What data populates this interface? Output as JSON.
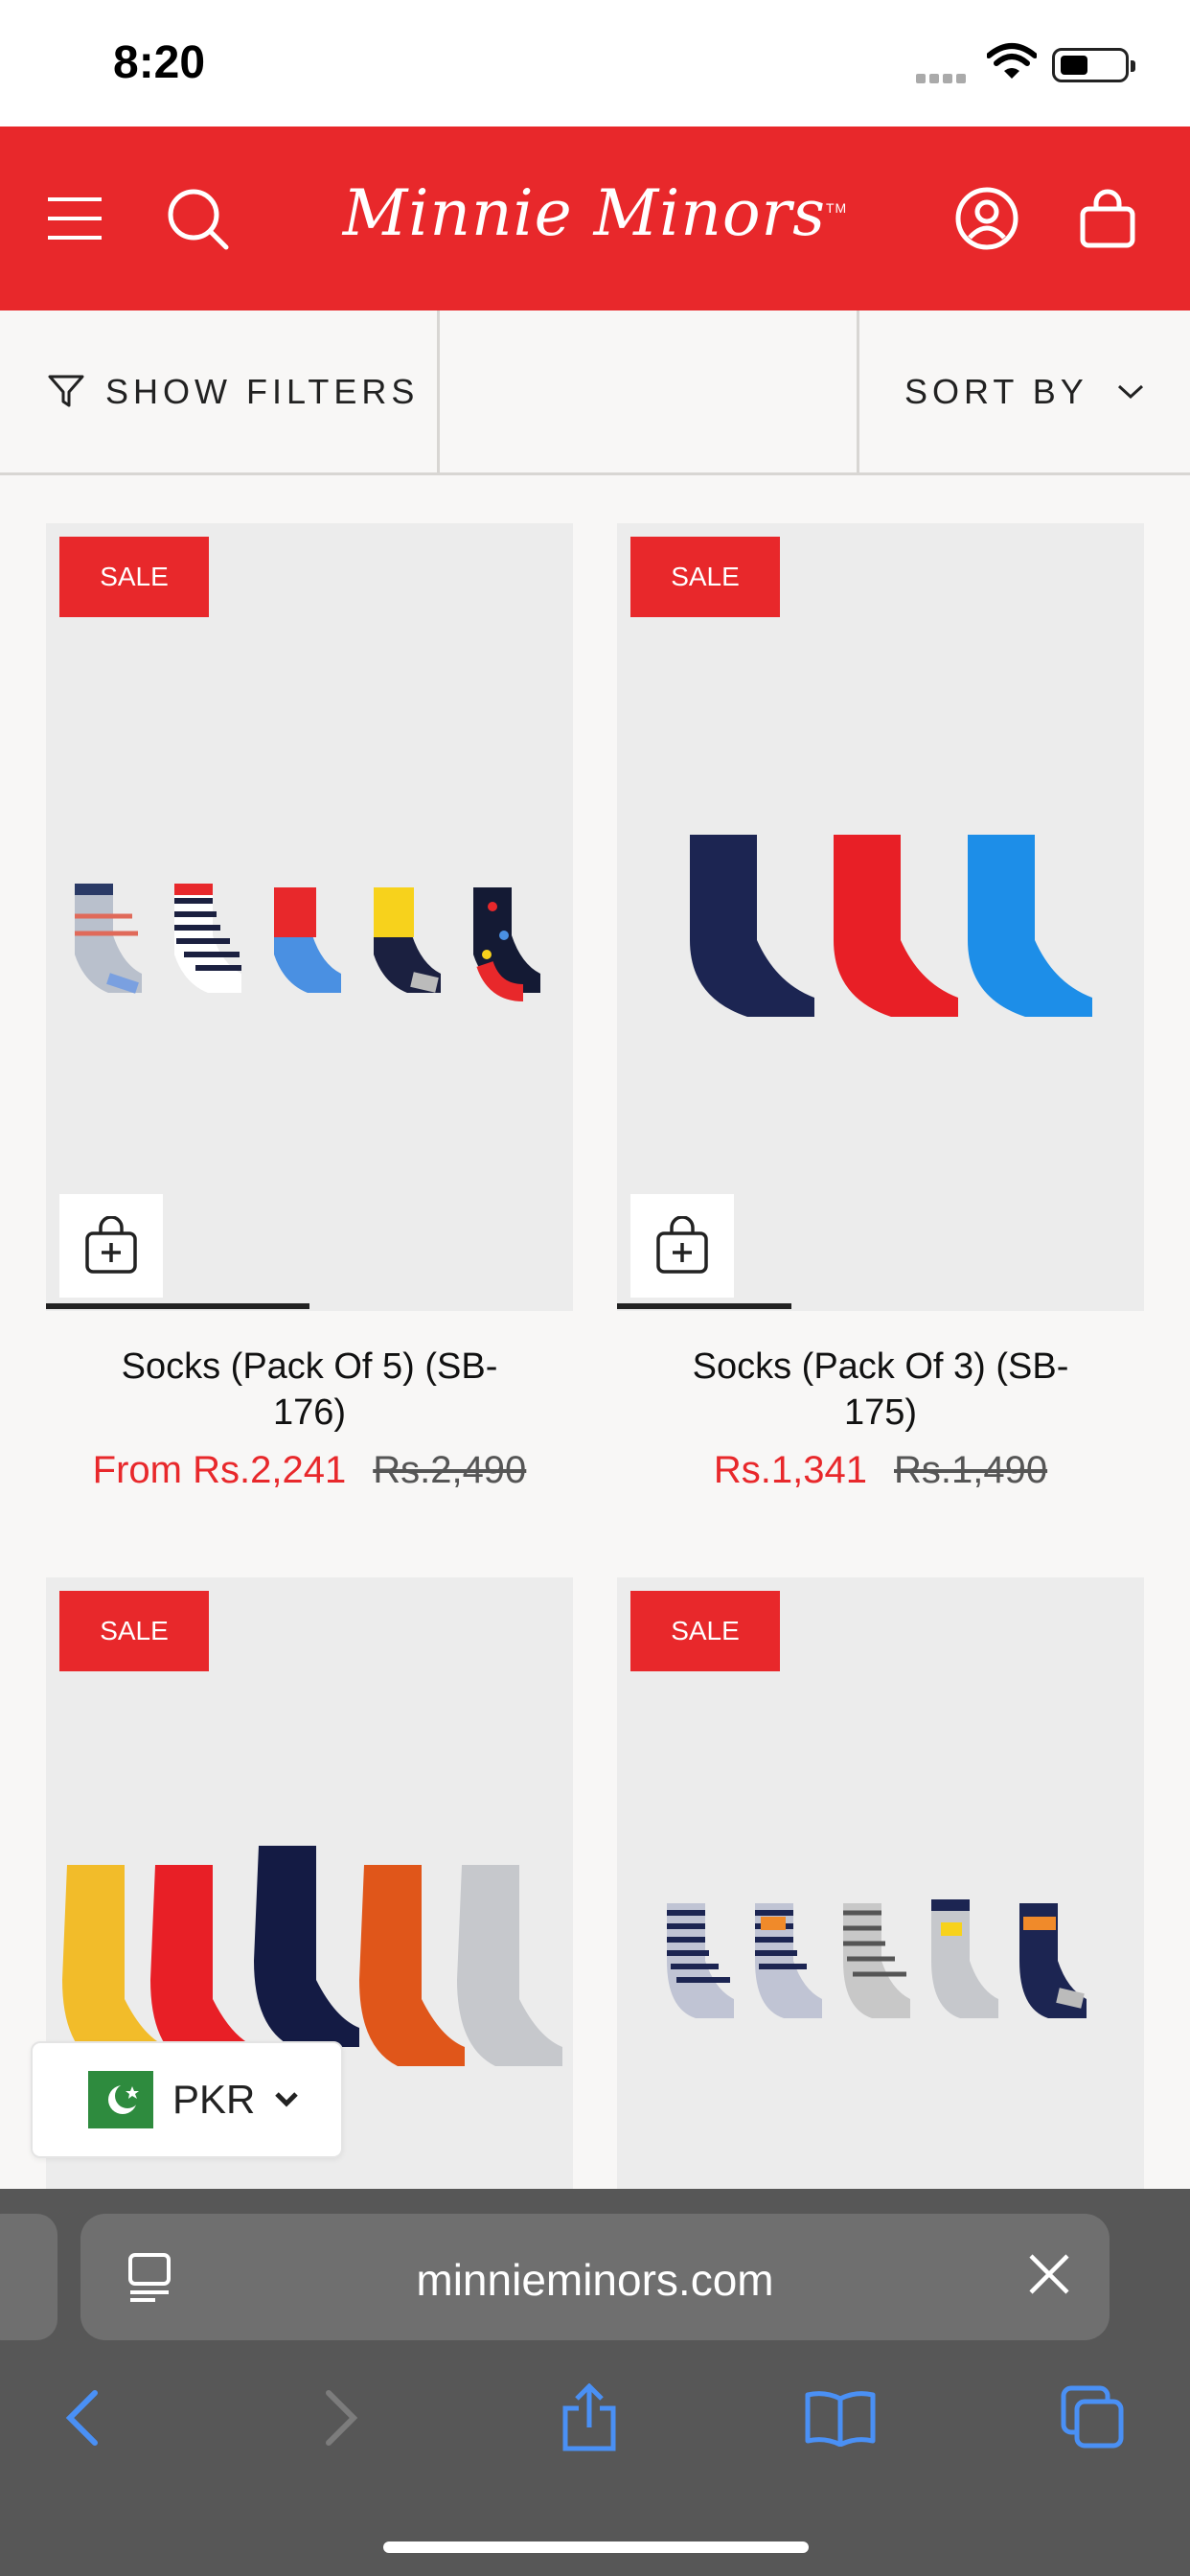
{
  "status_bar": {
    "time": "8:20"
  },
  "header": {
    "brand": "Minnie Minors",
    "trademark": "TM"
  },
  "filters": {
    "show_filters_label": "SHOW FILTERS",
    "sort_by_label": "SORT BY"
  },
  "products": [
    {
      "badge": "SALE",
      "title_line1": "Socks (Pack Of 5) (SB-",
      "title_line2": "176)",
      "price": "From Rs.2,241",
      "compare_price": "Rs.2,490",
      "gallery_progress": 0.5
    },
    {
      "badge": "SALE",
      "title_line1": "Socks (Pack Of 3) (SB-",
      "title_line2": "175)",
      "price": "Rs.1,341",
      "compare_price": "Rs.1,490",
      "gallery_progress": 0.33
    },
    {
      "badge": "SALE"
    },
    {
      "badge": "SALE"
    }
  ],
  "currency_selector": {
    "code": "PKR"
  },
  "browser": {
    "url": "minnieminors.com"
  },
  "colors": {
    "brand_red": "#e8282b",
    "browser_gray": "#575757"
  },
  "icons": [
    "menu-icon",
    "search-icon",
    "account-icon",
    "cart-icon",
    "filter-icon",
    "chevron-down-icon",
    "add-to-bag-icon",
    "close-icon",
    "back-icon",
    "forward-icon",
    "share-icon",
    "bookmarks-icon",
    "tabs-icon"
  ]
}
